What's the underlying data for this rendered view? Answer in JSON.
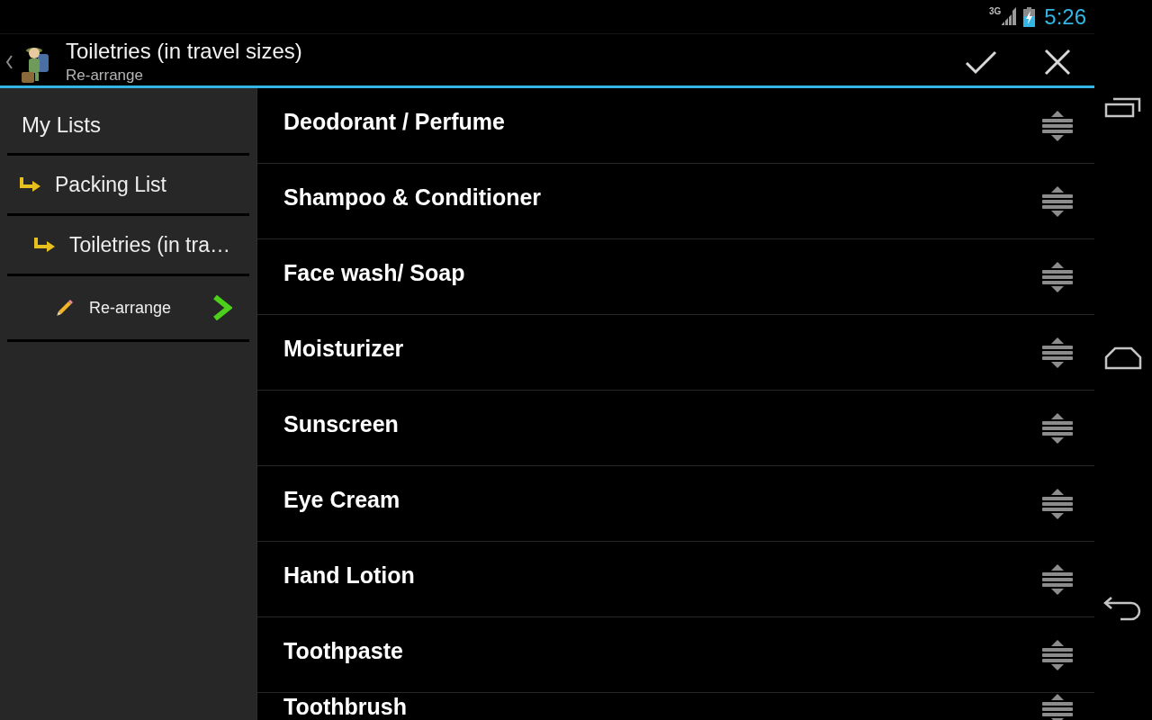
{
  "status_bar": {
    "network": "3G",
    "time": "5:26"
  },
  "action_bar": {
    "title": "Toiletries (in travel sizes)",
    "subtitle": "Re-arrange"
  },
  "sidebar": {
    "items": [
      {
        "kind": "home",
        "label": "My Lists",
        "children": [
          {
            "kind": "list",
            "label": "Packing List",
            "children": [
              {
                "kind": "list",
                "label": "Toiletries (in tra…",
                "children": [
                  {
                    "kind": "mode",
                    "label": "Re-arrange"
                  }
                ]
              }
            ]
          }
        ]
      }
    ]
  },
  "items": [
    {
      "label": "Deodorant / Perfume"
    },
    {
      "label": "Shampoo & Conditioner"
    },
    {
      "label": "Face wash/ Soap"
    },
    {
      "label": "Moisturizer"
    },
    {
      "label": "Sunscreen"
    },
    {
      "label": "Eye Cream"
    },
    {
      "label": "Hand Lotion"
    },
    {
      "label": "Toothpaste"
    },
    {
      "label": "Toothbrush"
    }
  ]
}
